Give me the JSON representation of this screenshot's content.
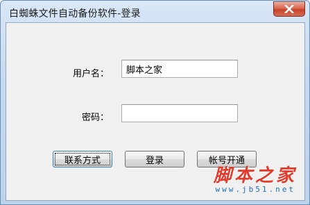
{
  "window": {
    "title": "白蜘蛛文件自动备份软件-登录",
    "close_symbol": "close-icon"
  },
  "form": {
    "username_label": "用户名：",
    "username_value": "脚本之家",
    "password_label": "密码：",
    "password_value": ""
  },
  "buttons": {
    "contact": "联系方式",
    "login": "登录",
    "register": "帐号开通"
  },
  "watermark": {
    "logo_text": "脚本之家",
    "url": "www.jb51.net"
  },
  "colors": {
    "close_button": "#c7432c",
    "watermark_logo": "#e23a2b",
    "watermark_url": "#1f6fb5"
  }
}
